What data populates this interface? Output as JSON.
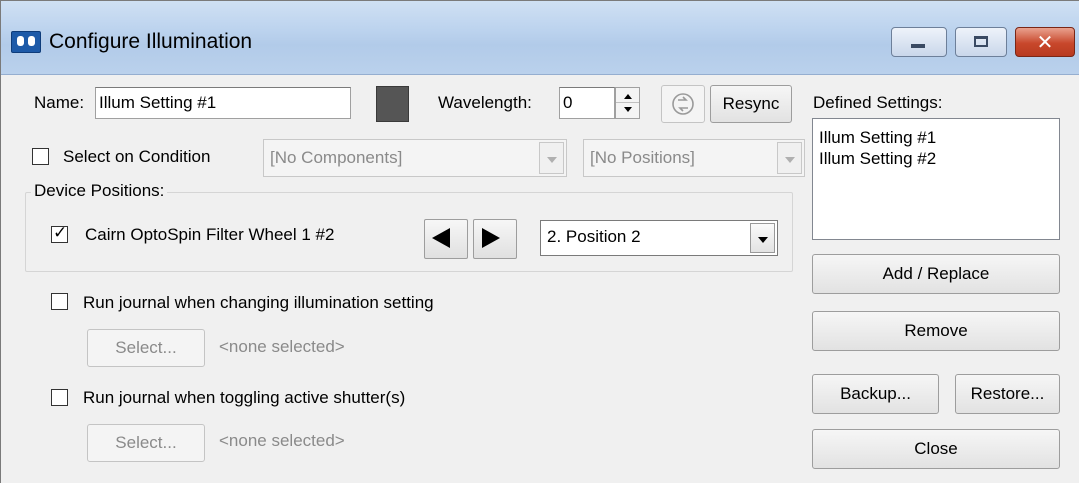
{
  "window": {
    "title": "Configure Illumination",
    "minimize_icon": "minimize-icon",
    "maximize_icon": "maximize-icon",
    "close_icon": "close-icon",
    "close_glyph": "✕",
    "accent_color": "#c8472b"
  },
  "form": {
    "name_label": "Name:",
    "name_value": "Illum Setting #1",
    "swatch_color": "#555555",
    "wavelength_label": "Wavelength:",
    "wavelength_value": "0",
    "resync_icon": "refresh-icon",
    "resync_label": "Resync",
    "select_on_condition_label": "Select on Condition",
    "select_on_condition_checked": false,
    "components_combo": "[No Components]",
    "positions_combo": "[No Positions]"
  },
  "device_positions": {
    "legend": "Device Positions:",
    "device_label": "Cairn OptoSpin Filter Wheel 1 #2",
    "device_checked": true,
    "checkmark": "✓",
    "position_value": "2. Position 2"
  },
  "journals": {
    "changing_label": "Run journal when changing illumination setting",
    "changing_select_label": "Select...",
    "changing_selected": "<none selected>",
    "toggling_label": "Run journal when toggling active shutter(s)",
    "toggling_select_label": "Select...",
    "toggling_selected": "<none selected>"
  },
  "defined_settings": {
    "label": "Defined Settings:",
    "items": [
      "Illum Setting #1",
      "Illum Setting #2"
    ]
  },
  "buttons": {
    "add_replace": "Add / Replace",
    "remove": "Remove",
    "backup": "Backup...",
    "restore": "Restore...",
    "close": "Close"
  }
}
